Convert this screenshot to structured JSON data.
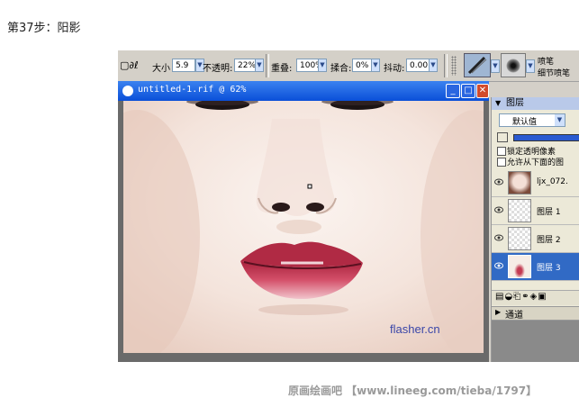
{
  "caption": "第37步：阳影",
  "toolbar": {
    "size_label": "大小",
    "size_value": "5.9",
    "opacity_label": "不透明:",
    "opacity_value": "22%",
    "overlap_label": "重叠:",
    "overlap_value": "100%",
    "blend_label": "揉合:",
    "blend_value": "0%",
    "jitter_label": "抖动:",
    "jitter_value": "0.00",
    "brush_name": "喷笔",
    "brush_variant": "细节喷笔"
  },
  "document_window": {
    "title": "untitled-1.rif @ 62%",
    "canvas_watermark": "flasher.cn"
  },
  "layers_panel": {
    "title": "图层",
    "composite_method": "默认值",
    "lock_transparency_label": "锁定透明像素",
    "pick_up_underlying_label": "允许从下面的图",
    "layers": [
      {
        "name": "ljx_072."
      },
      {
        "name": "图层 1"
      },
      {
        "name": "图层 2"
      },
      {
        "name": "图层 3"
      }
    ],
    "channels_label": "通道"
  },
  "site_watermark": "原画绘画吧 【www.lineeg.com/tieba/1797】",
  "colors": {
    "titlebar": "#0a4fd8",
    "selected_layer": "#316ac5",
    "skin": "#f6ece6",
    "lips": "#c33a52"
  }
}
